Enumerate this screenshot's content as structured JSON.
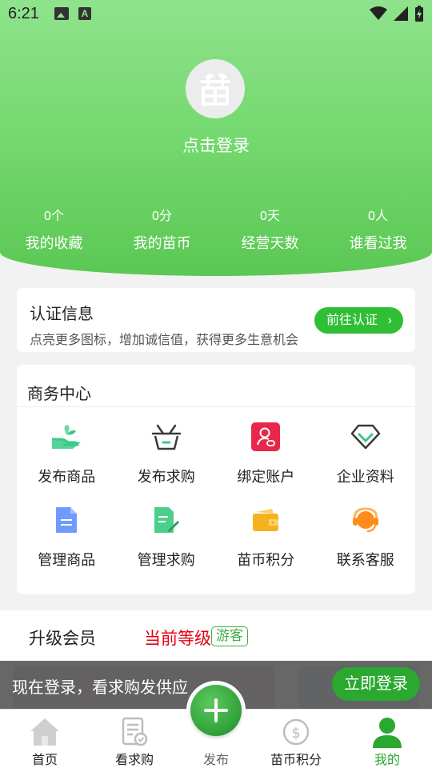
{
  "status_bar": {
    "time": "6:21"
  },
  "profile": {
    "login_prompt": "点击登录"
  },
  "stats": [
    {
      "value": "0个",
      "label": "我的收藏"
    },
    {
      "value": "0分",
      "label": "我的苗币"
    },
    {
      "value": "0天",
      "label": "经营天数"
    },
    {
      "value": "0人",
      "label": "谁看过我"
    }
  ],
  "auth": {
    "title": "认证信息",
    "description": "点亮更多图标，增加诚信值，获得更多生意机会",
    "button": "前往认证",
    "button_chevron": "›"
  },
  "business": {
    "title": "商务中心",
    "items": [
      {
        "label": "发布商品",
        "icon": "hand-plant-icon",
        "color": "#3cc98a"
      },
      {
        "label": "发布求购",
        "icon": "basket-icon",
        "color": "#3a3a3a"
      },
      {
        "label": "绑定账户",
        "icon": "account-link-icon",
        "color": "#e8274b"
      },
      {
        "label": "企业资料",
        "icon": "diamond-icon",
        "color": "#3a3a3a"
      },
      {
        "label": "管理商品",
        "icon": "document-icon",
        "color": "#6f9bff"
      },
      {
        "label": "管理求购",
        "icon": "edit-document-icon",
        "color": "#4ccf8c"
      },
      {
        "label": "苗币积分",
        "icon": "wallet-icon",
        "color": "#f5b21f"
      },
      {
        "label": "联系客服",
        "icon": "headset-icon",
        "color": "#ff8c1a"
      }
    ]
  },
  "member": {
    "title": "升级会员",
    "level_label": "当前等级",
    "level_badge": "游客"
  },
  "login_banner": {
    "text": "现在登录，看求购发供应",
    "button": "立即登录"
  },
  "tabs": [
    {
      "label": "首页",
      "icon": "home-icon"
    },
    {
      "label": "看求购",
      "icon": "request-list-icon"
    },
    {
      "label": "发布",
      "icon": "plus-icon"
    },
    {
      "label": "苗币积分",
      "icon": "coin-icon"
    },
    {
      "label": "我的",
      "icon": "user-icon"
    }
  ],
  "colors": {
    "brand_green": "#2aa82f",
    "header_green": "#74d86f",
    "level_red": "#e60012"
  }
}
